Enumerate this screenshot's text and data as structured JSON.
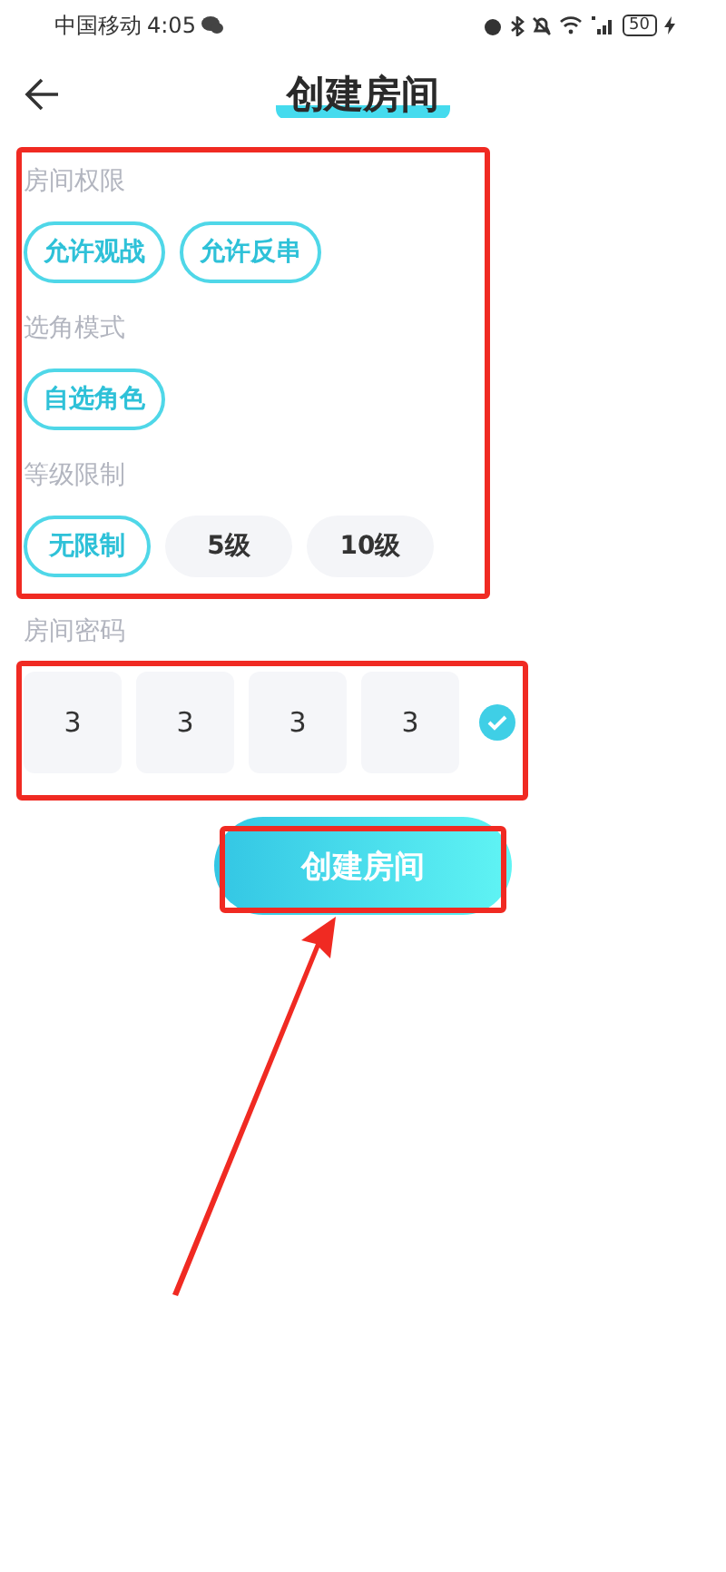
{
  "status_bar": {
    "carrier": "中国移动",
    "time": "4:05",
    "battery": "50"
  },
  "header": {
    "title": "创建房间"
  },
  "sections": [
    {
      "label": "房间权限",
      "options": [
        {
          "label": "允许观战",
          "selected": true
        },
        {
          "label": "允许反串",
          "selected": true
        }
      ]
    },
    {
      "label": "选角模式",
      "options": [
        {
          "label": "自选角色",
          "selected": true
        }
      ]
    },
    {
      "label": "等级限制",
      "options": [
        {
          "label": "无限制",
          "selected": true
        },
        {
          "label": "5级",
          "selected": false
        },
        {
          "label": "10级",
          "selected": false
        }
      ]
    }
  ],
  "password": {
    "label": "房间密码",
    "digits": [
      "3",
      "3",
      "3",
      "3"
    ],
    "confirmed": true
  },
  "create_button": {
    "label": "创建房间"
  }
}
